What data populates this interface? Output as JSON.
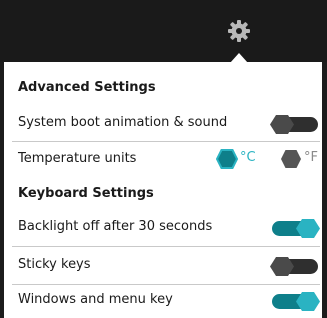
{
  "colors": {
    "accent": "#0e7f8a",
    "accent_light": "#2ab3c2",
    "toggle_off": "#2f2f2f",
    "text": "#1a1a1a",
    "unit_inactive": "#8a8a8a",
    "header_bg": "#1a1a1a",
    "panel_bg": "#ffffff"
  },
  "header": {
    "icon": "gear-icon"
  },
  "sections": {
    "advanced": "Advanced Settings",
    "keyboard": "Keyboard Settings"
  },
  "settings": {
    "boot_animation": {
      "label": "System boot animation & sound",
      "enabled": false
    },
    "temperature": {
      "label": "Temperature units",
      "options": [
        {
          "label": "°C",
          "selected": true
        },
        {
          "label": "°F",
          "selected": false
        }
      ]
    },
    "backlight": {
      "label": "Backlight off after 30 seconds",
      "enabled": true
    },
    "sticky_keys": {
      "label": "Sticky keys",
      "enabled": false
    },
    "windows_menu_key": {
      "label": "Windows and menu key",
      "enabled": true
    }
  }
}
